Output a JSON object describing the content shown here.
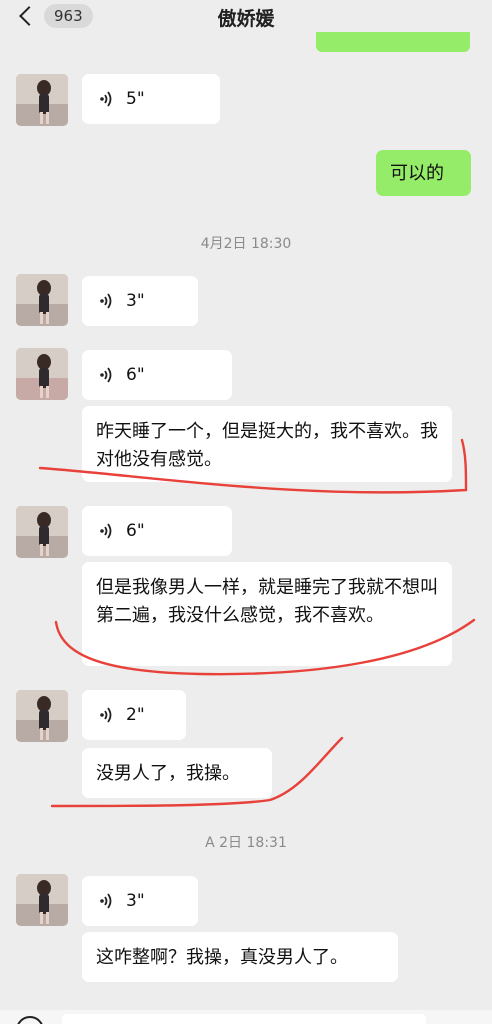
{
  "header": {
    "unread_count": "963",
    "title": "傲娇媛"
  },
  "messages": {
    "voice_1": "5\"",
    "me_1": "可以的",
    "time_1": "4月2日 18:30",
    "voice_2": "3\"",
    "voice_3": "6\"",
    "text_1": "昨天睡了一个，但是挺大的，我不喜欢。我对他没有感觉。",
    "voice_4": "6\"",
    "text_2": "但是我像男人一样，就是睡完了我就不想叫第二遍，我没什么感觉，我不喜欢。",
    "voice_5": "2\"",
    "text_3": "没男人了，我操。",
    "time_2": "A 2日 18:31",
    "voice_6": "3\"",
    "text_4": "这咋整啊？我操，真没男人了。"
  },
  "colors": {
    "background": "#ededed",
    "my_bubble": "#95ec69",
    "their_bubble": "#ffffff",
    "annotation_red": "#e8413a"
  }
}
